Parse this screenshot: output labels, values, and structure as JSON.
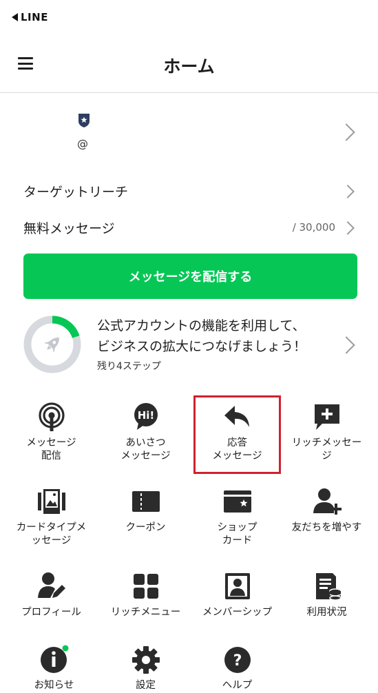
{
  "status_bar": {
    "back_app": "LINE"
  },
  "header": {
    "title": "ホーム"
  },
  "account": {
    "at_sign": "@"
  },
  "rows": [
    {
      "label": "ターゲットリーチ",
      "value": ""
    },
    {
      "label": "無料メッセージ",
      "value": "/ 30,000"
    }
  ],
  "send_button": {
    "label": "メッセージを配信する"
  },
  "progress": {
    "title_line1": "公式アカウントの機能を利用して、",
    "title_line2": "ビジネスの拡大につなげましょう！",
    "subtitle": "残り4ステップ",
    "completed_fraction": 0.2
  },
  "colors": {
    "accent": "#06c755",
    "highlight": "#d0202e",
    "icon": "#2b2b2b",
    "badge": "#06c755"
  },
  "menu_tiles": [
    {
      "label": "メッセージ\n配信",
      "icon": "broadcast-icon"
    },
    {
      "label": "あいさつ\nメッセージ",
      "icon": "greeting-hi-icon"
    },
    {
      "label": "応答\nメッセージ",
      "icon": "reply-arrow-icon"
    },
    {
      "label": "リッチメッセー\nジ",
      "icon": "rich-message-icon"
    },
    {
      "label": "カードタイプメ\nッセージ",
      "icon": "card-type-icon"
    },
    {
      "label": "クーポン",
      "icon": "coupon-icon"
    },
    {
      "label": "ショップ\nカード",
      "icon": "shop-card-icon"
    },
    {
      "label": "友だちを増やす",
      "icon": "add-friend-icon"
    },
    {
      "label": "プロフィール",
      "icon": "profile-edit-icon"
    },
    {
      "label": "リッチメニュー",
      "icon": "rich-menu-icon"
    },
    {
      "label": "メンバーシップ",
      "icon": "membership-icon"
    },
    {
      "label": "利用状況",
      "icon": "usage-report-icon"
    },
    {
      "label": "お知らせ",
      "icon": "info-icon"
    },
    {
      "label": "設定",
      "icon": "gear-icon"
    },
    {
      "label": "ヘルプ",
      "icon": "help-icon"
    }
  ]
}
